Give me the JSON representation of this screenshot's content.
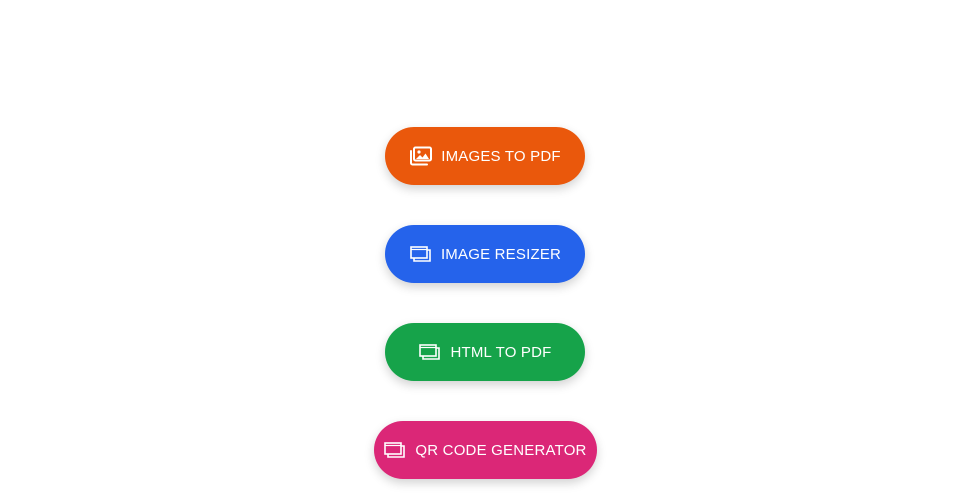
{
  "tools": [
    {
      "label": "IMAGES TO PDF",
      "icon": "images-icon",
      "color": "#EA580C"
    },
    {
      "label": "IMAGE RESIZER",
      "icon": "stacked-windows-icon",
      "color": "#2563EB"
    },
    {
      "label": "HTML TO PDF",
      "icon": "stacked-windows-icon",
      "color": "#16A34A"
    },
    {
      "label": "QR CODE GENERATOR",
      "icon": "stacked-windows-icon",
      "color": "#DB2777"
    }
  ]
}
